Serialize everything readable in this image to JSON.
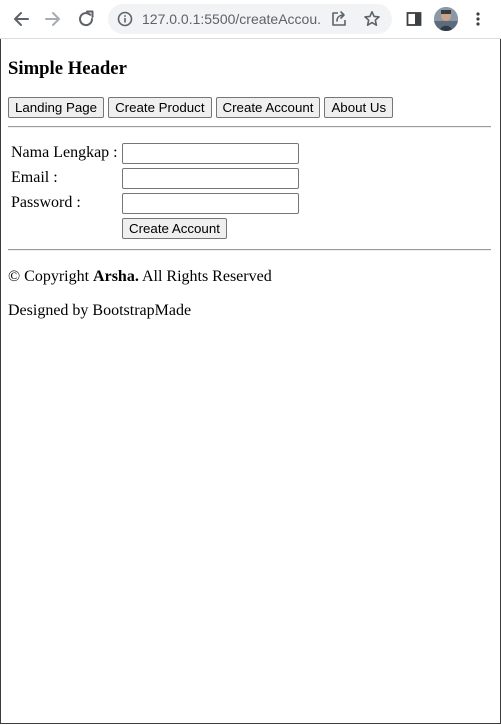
{
  "browser": {
    "url": "127.0.0.1:5500/createAccou...",
    "icons": {
      "back": "arrow-left-icon",
      "forward": "arrow-right-icon",
      "reload": "reload-icon",
      "site_info": "info-icon",
      "share": "share-icon",
      "bookmark": "star-icon",
      "side_panel": "side-panel-icon",
      "menu": "kebab-menu-icon"
    }
  },
  "page": {
    "title": "Simple Header",
    "nav": [
      {
        "label": "Landing Page"
      },
      {
        "label": "Create Product"
      },
      {
        "label": "Create Account"
      },
      {
        "label": "About Us"
      }
    ],
    "form": {
      "fields": [
        {
          "label": "Nama Lengkap :",
          "value": ""
        },
        {
          "label": "Email :",
          "value": ""
        },
        {
          "label": "Password :",
          "value": ""
        }
      ],
      "submit_label": "Create Account"
    },
    "footer": {
      "copyright_prefix": "© Copyright ",
      "brand": "Arsha.",
      "copyright_suffix": " All Rights Reserved",
      "designed_by": "Designed by BootstrapMade"
    }
  }
}
